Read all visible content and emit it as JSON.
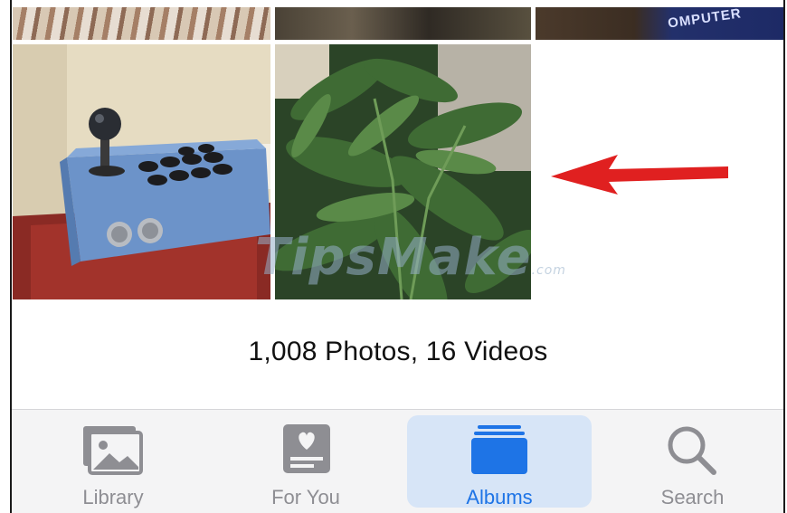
{
  "summary": {
    "count_text": "1,008 Photos, 16 Videos"
  },
  "thumb_top3_text": "OMPUTER",
  "watermark": {
    "text": "TipsMake",
    "suffix": ".com"
  },
  "tabs": [
    {
      "label": "Library",
      "icon": "photo-stack-icon",
      "selected": false
    },
    {
      "label": "For You",
      "icon": "for-you-card-icon",
      "selected": false
    },
    {
      "label": "Albums",
      "icon": "albums-stack-icon",
      "selected": true
    },
    {
      "label": "Search",
      "icon": "magnifier-icon",
      "selected": false
    }
  ],
  "colors": {
    "accent": "#1e74e6",
    "tab_inactive": "#8e8e93",
    "selected_tab_bg": "#d7e5f7",
    "annotation_arrow": "#e02020"
  }
}
